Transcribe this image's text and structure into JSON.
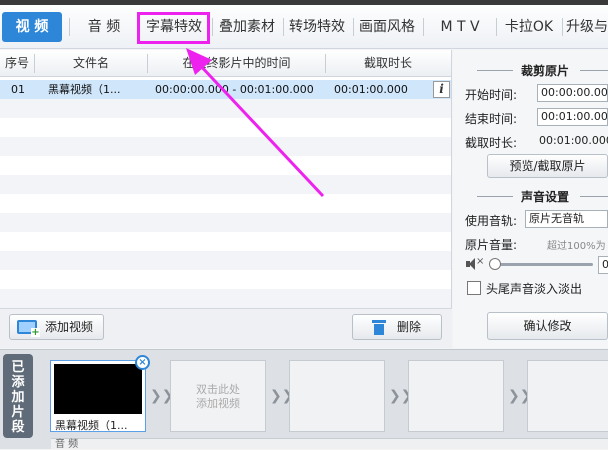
{
  "tabs": [
    {
      "label": "视 频",
      "active": true
    },
    {
      "label": "音 频"
    },
    {
      "label": "字幕特效",
      "highlighted": true
    },
    {
      "label": "叠加素材"
    },
    {
      "label": "转场特效"
    },
    {
      "label": "画面风格"
    },
    {
      "label": "M T V"
    },
    {
      "label": "卡拉OK"
    },
    {
      "label": "升级与"
    }
  ],
  "table": {
    "headers": [
      "序号",
      "文件名",
      "在最终影片中的时间",
      "截取时长"
    ],
    "rows": [
      {
        "index": "01",
        "filename": "黑幕视频（1...",
        "time": "00:00:00.000 - 00:01:00.000",
        "duration": "00:01:00.000"
      }
    ]
  },
  "toolbar": {
    "add_video": "添加视频",
    "delete": "删除"
  },
  "crop": {
    "title": "裁剪原片",
    "start_label": "开始时间:",
    "start_value": "00:00:00.00",
    "end_label": "结束时间:",
    "end_value": "00:01:00.00",
    "length_label": "截取时长:",
    "length_value": "00:01:00.000",
    "preview_button": "预览/截取原片"
  },
  "sound": {
    "title": "声音设置",
    "track_label": "使用音轨:",
    "track_value": "原片无音轨",
    "volume_label": "原片音量:",
    "volume_hint": "超过100%为",
    "volume_value": "0",
    "volume_level": 0,
    "fade_label": "头尾声音淡入淡出",
    "confirm_button": "确认修改"
  },
  "timeline": {
    "side_label": "已添加片段",
    "clip_name": "黑幕视频（1...",
    "placeholder_line1": "双击此处",
    "placeholder_line2": "添加视频",
    "audio_label": "音 频"
  },
  "colors": {
    "accent": "#2e86d8",
    "highlight": "#ee22ee",
    "selected_row": "#cfe6fb"
  }
}
